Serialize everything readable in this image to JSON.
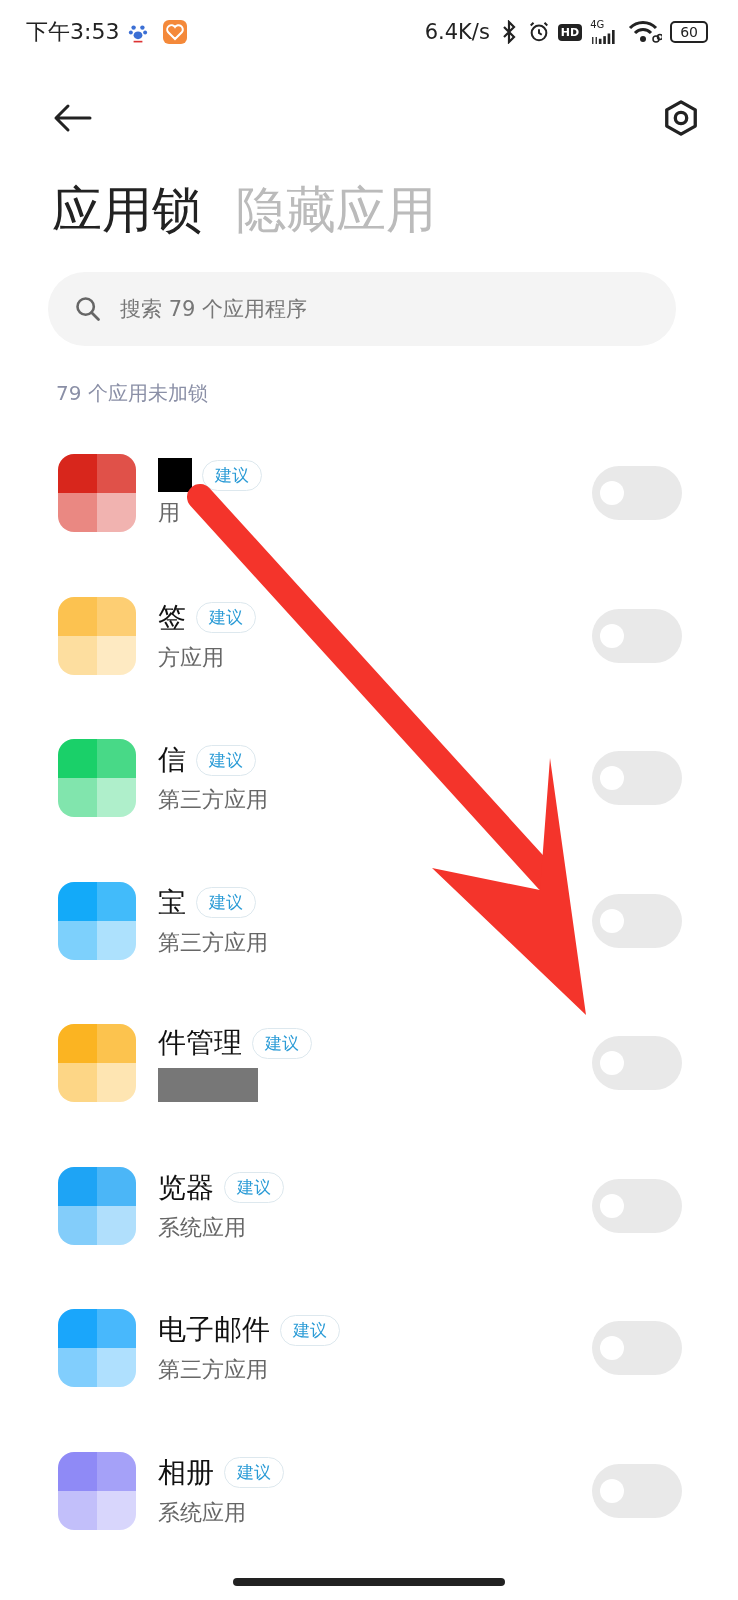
{
  "status_bar": {
    "time": "下午3:53",
    "speed": "6.4K/s",
    "hd": "HD",
    "network": "4G",
    "battery": "60"
  },
  "tabs": [
    {
      "label": "应用锁",
      "selected": true
    },
    {
      "label": "隐藏应用",
      "selected": false
    }
  ],
  "search": {
    "placeholder": "搜索 79 个应用程序"
  },
  "section_header": "79 个应用未加锁",
  "apps": [
    {
      "subtitle": "用",
      "badge": "建议",
      "on": false,
      "color": "#d8261c"
    },
    {
      "name": "签",
      "subtitle": "方应用",
      "badge": "建议",
      "on": false,
      "color": "#fcc250"
    },
    {
      "name": "信",
      "subtitle": "第三方应用",
      "badge": "建议",
      "on": false,
      "color": "#1ad069"
    },
    {
      "name": "宝",
      "subtitle": "第三方应用",
      "badge": "建议",
      "on": false,
      "color": "#13aaf9"
    },
    {
      "name": "件管理",
      "badge": "建议",
      "on": false,
      "color": "#fbb422"
    },
    {
      "name": "览器",
      "subtitle": "系统应用",
      "badge": "建议",
      "on": false,
      "color": "#1ea4f5"
    },
    {
      "name": "电子邮件",
      "subtitle": "第三方应用",
      "badge": "建议",
      "on": false,
      "color": "#1aa6fb"
    },
    {
      "name": "相册",
      "subtitle": "系统应用",
      "badge": "建议",
      "on": false,
      "color": "#8f8af6"
    }
  ]
}
